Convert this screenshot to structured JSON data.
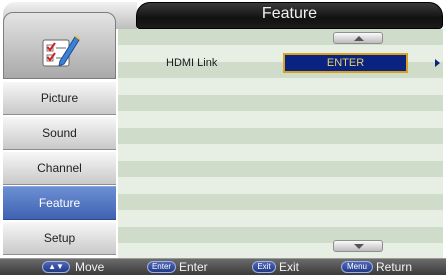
{
  "header": {
    "title": "Feature"
  },
  "sidebar": {
    "icon": "checklist-pencil-icon",
    "items": [
      {
        "label": "Picture",
        "active": false
      },
      {
        "label": "Sound",
        "active": false
      },
      {
        "label": "Channel",
        "active": false
      },
      {
        "label": "Feature",
        "active": true
      },
      {
        "label": "Setup",
        "active": false
      }
    ]
  },
  "settings": [
    {
      "label": "HDMI Link",
      "value": "ENTER"
    }
  ],
  "hints": [
    {
      "key": "▲▼",
      "action": "Move"
    },
    {
      "key": "Enter",
      "action": "Enter"
    },
    {
      "key": "Exit",
      "action": "Exit"
    },
    {
      "key": "Menu",
      "action": "Return"
    }
  ],
  "colors": {
    "accent_blue": "#4a6cc0",
    "highlight_border": "#d7a21e",
    "highlight_fill": "#0a2280"
  }
}
